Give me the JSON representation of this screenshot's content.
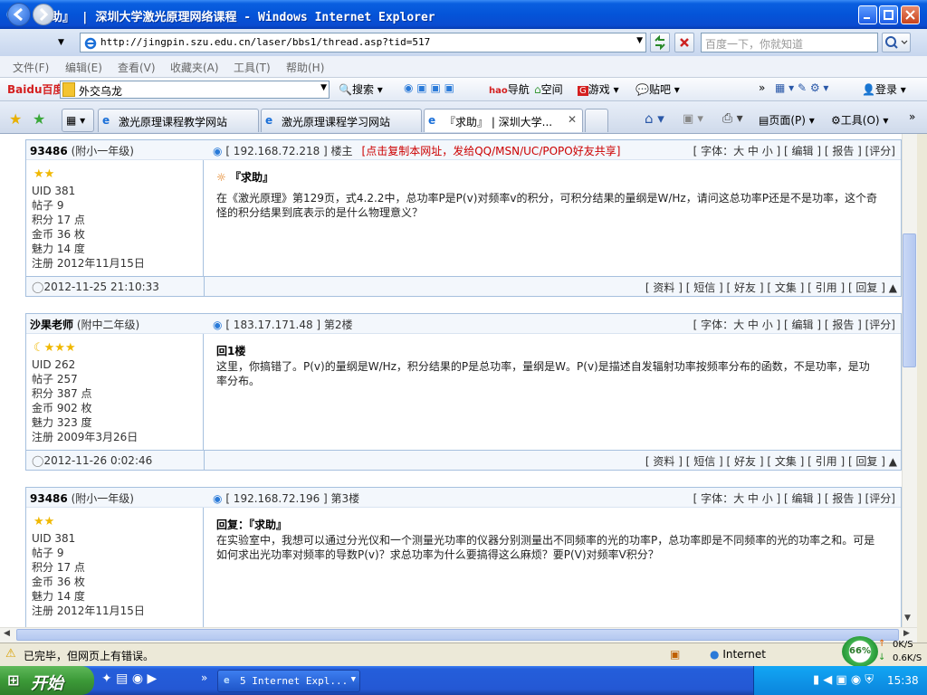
{
  "window": {
    "title": "『求助』 | 深圳大学激光原理网络课程 - Windows Internet Explorer"
  },
  "address": {
    "url": "http://jingpin.szu.edu.cn/laser/bbs1/thread.asp?tid=517",
    "search_placeholder": "百度一下，你就知道"
  },
  "menu": [
    "文件(F)",
    "编辑(E)",
    "查看(V)",
    "收藏夹(A)",
    "工具(T)",
    "帮助(H)"
  ],
  "baidu_toolbar": {
    "logo": "Baidu百度",
    "input_value": "外交乌龙",
    "items": [
      "搜索",
      "导航",
      "空间",
      "游戏",
      "贴吧",
      "登录"
    ]
  },
  "tabs": [
    {
      "label": "激光原理课程教学网站"
    },
    {
      "label": "激光原理课程学习网站"
    },
    {
      "label": "『求助』 | 深圳大学..."
    }
  ],
  "tab_tools": {
    "page": "页面(P)",
    "tools": "工具(O)"
  },
  "posts": [
    {
      "user": "93486",
      "level": "(附小一年级)",
      "ip": "[ 192.168.72.218 ] 楼主",
      "share": "[点击复制本网址，发给QQ/MSN/UC/POPO好友共享]",
      "tools": "[ 字体：大 中 小 ] [ 编辑 ] [ 报告 ] [评分]",
      "info": [
        "UID 381",
        "帖子 9",
        "积分 17 点",
        "金币 36 枚",
        "魅力 14 度",
        "注册 2012年11月15日"
      ],
      "title": "『求助』",
      "body": "在《激光原理》第129页，式4.2.2中，总功率P是P(v)对频率v的积分，可积分结果的量纲是W/Hz，请问这总功率P还是不是功率，这个奇怪的积分结果到底表示的是什么物理意义？",
      "time": "2012-11-25 21:10:33",
      "foot": "[ 资料 ] [ 短信 ] [ 好友 ] [ 文集 ] [ 引用 ] [ 回复 ]"
    },
    {
      "user": "沙果老师",
      "level": "(附中二年级)",
      "ip": "[ 183.17.171.48 ] 第2楼",
      "share": "",
      "tools": "[ 字体：大 中 小 ] [ 编辑 ] [ 报告 ] [评分]",
      "info": [
        "UID 262",
        "帖子 257",
        "积分 387 点",
        "金币 902 枚",
        "魅力 323 度",
        "注册 2009年3月26日"
      ],
      "title": "回1楼",
      "body": "这里，你搞错了。P(v)的量纲是W/Hz，积分结果的P是总功率，量纲是W。P(v)是描述自发辐射功率按频率分布的函数，不是功率，是功率分布。",
      "time": "2012-11-26 0:02:46",
      "foot": "[ 资料 ] [ 短信 ] [ 好友 ] [ 文集 ] [ 引用 ] [ 回复 ]"
    },
    {
      "user": "93486",
      "level": "(附小一年级)",
      "ip": "[ 192.168.72.196 ] 第3楼",
      "share": "",
      "tools": "[ 字体：大 中 小 ] [ 编辑 ] [ 报告 ] [评分]",
      "info": [
        "UID 381",
        "帖子 9",
        "积分 17 点",
        "金币 36 枚",
        "魅力 14 度",
        "注册 2012年11月15日"
      ],
      "title": "回复：『求助』",
      "body": "在实验室中，我想可以通过分光仪和一个测量光功率的仪器分别测量出不同频率的光的功率P，总功率即是不同频率的光的功率之和。可是如何求出光功率对频率的导数P(v)？求总功率为什么要搞得这么麻烦？要P(V)对频率V积分？",
      "time": "",
      "foot": ""
    }
  ],
  "status": {
    "text": "已完毕，但网页上有错误。",
    "zone": "Internet",
    "speed_pct": "66%",
    "up": "0K/S",
    "down": "0.6K/S"
  },
  "taskbar": {
    "start": "开始",
    "task": "5 Internet Expl...",
    "clock": "15:38"
  }
}
